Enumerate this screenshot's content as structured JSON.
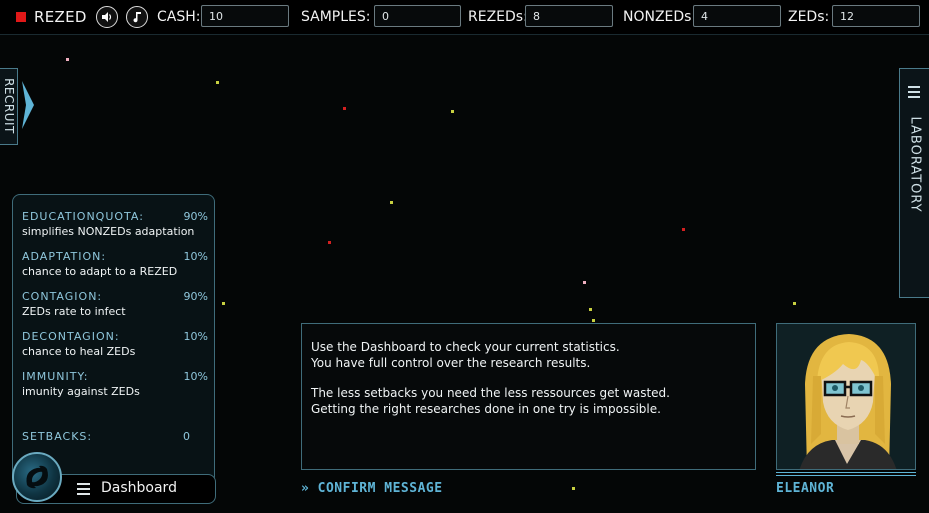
{
  "topbar": {
    "app_title": "REZED",
    "sound_icon": "speaker-icon",
    "music_icon": "music-note-icon",
    "cash_label": "CASH:",
    "cash_value": "10",
    "samples_label": "SAMPLES:",
    "samples_value": "0",
    "rezeds_label": "REZEDs:",
    "rezeds_value": "8",
    "nonzeds_label": "NONZEDs:",
    "nonzeds_value": "4",
    "zeds_label": "ZEDs:",
    "zeds_value": "12"
  },
  "recruit_tab": {
    "label": "RECRUIT"
  },
  "laboratory_tab": {
    "label": "LABORATORY"
  },
  "dashboard": {
    "stats": [
      {
        "name": "EDUCATIONQUOTA:",
        "value": "90%",
        "desc": "simplifies NONZEDs adaptation"
      },
      {
        "name": "ADAPTATION:",
        "value": "10%",
        "desc": "chance to adapt to a REZED"
      },
      {
        "name": "CONTAGION:",
        "value": "90%",
        "desc": "ZEDs rate to infect"
      },
      {
        "name": "DECONTAGION:",
        "value": "10%",
        "desc": "chance to heal ZEDs"
      },
      {
        "name": "IMMUNITY:",
        "value": "10%",
        "desc": "imunity against ZEDs"
      }
    ],
    "setbacks_label": "SETBACKS:",
    "setbacks_value": "0",
    "footer_label": "Dashboard"
  },
  "message": {
    "line1": "Use the Dashboard to check your current statistics.",
    "line2": "You have full control over the research results.",
    "line3": "The less setbacks you need the less ressources get wasted.",
    "line4": "Getting the right researches done in one try is impossible.",
    "confirm_label": "CONFIRM MESSAGE"
  },
  "character": {
    "name": "ELEANOR"
  },
  "colors": {
    "accent": "#5fb4d6",
    "panel_border": "#3f6c7a",
    "logo_red": "#e01818",
    "zed_red": "#d42020",
    "nonzed_yellow": "#c8d040",
    "rezed_pink": "#f0b0c0"
  }
}
